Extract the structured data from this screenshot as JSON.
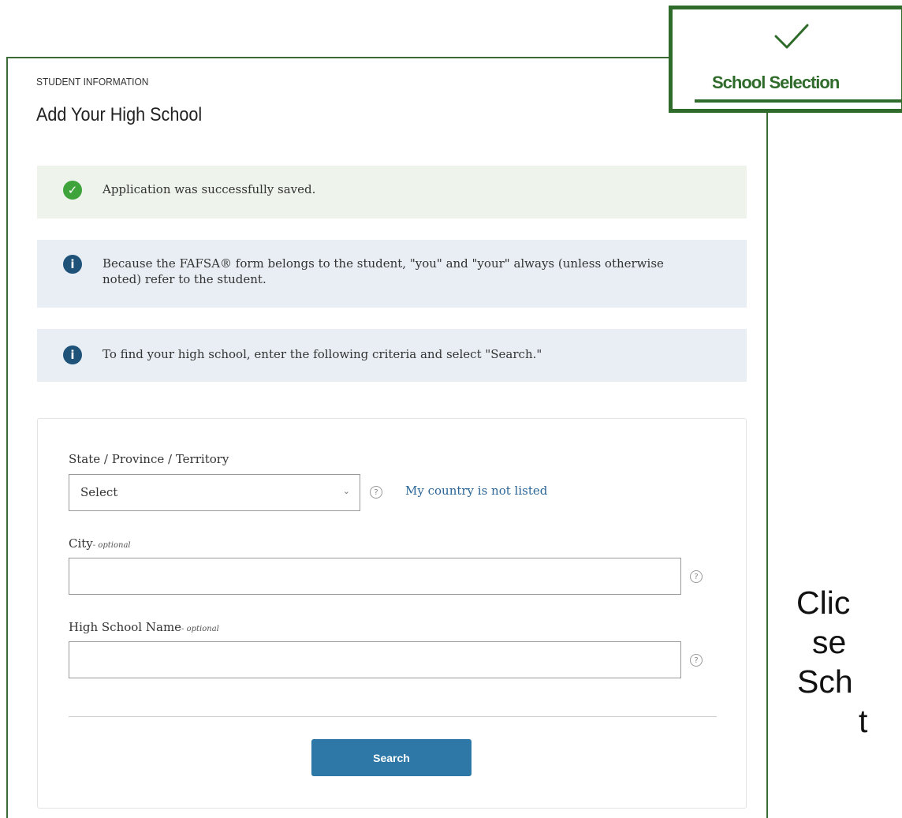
{
  "header": {
    "section_kicker": "STUDENT INFORMATION",
    "title": "Add Your High School"
  },
  "alerts": {
    "success": "Application was successfully saved.",
    "info_ownership": "Because the FAFSA® form belongs to the student, \"you\" and \"your\" always (unless otherwise noted) refer to the student.",
    "info_search": "To find your high school, enter the following criteria and select \"Search.\""
  },
  "form": {
    "state_label": "State / Province / Territory",
    "state_value": "Select",
    "country_link": "My country is not listed",
    "city_label": "City",
    "city_optional": "- optional",
    "city_value": "",
    "school_label": "High School Name",
    "school_optional": "- optional",
    "school_value": "",
    "search_button": "Search",
    "help_glyph": "?"
  },
  "step_indicator": {
    "label": "School Selection",
    "status": "complete",
    "color": "#2f6b2a"
  },
  "annotation": {
    "lines": [
      "Clic",
      "se",
      "Sch",
      "t"
    ]
  },
  "icons": {
    "success": "check-circle-icon",
    "info": "info-circle-icon",
    "step": "checkmark-icon"
  }
}
